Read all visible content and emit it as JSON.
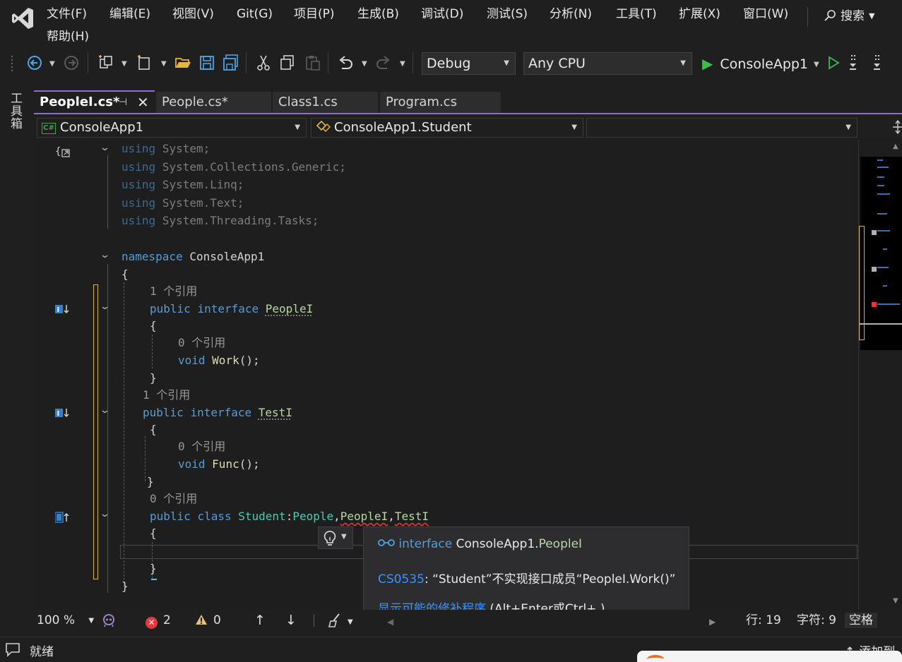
{
  "menu": {
    "items": [
      "文件(F)",
      "编辑(E)",
      "视图(V)",
      "Git(G)",
      "项目(P)",
      "生成(B)",
      "调试(D)",
      "测试(S)",
      "分析(N)",
      "工具(T)",
      "扩展(X)",
      "窗口(W)",
      "帮助(H)"
    ],
    "search_label": "搜索"
  },
  "toolbar": {
    "configuration": "Debug",
    "platform": "Any CPU",
    "startup_project": "ConsoleApp1"
  },
  "toolbox_label": "工具箱",
  "tabs": [
    {
      "label": "PeopleI.cs*",
      "active": true
    },
    {
      "label": "People.cs*",
      "active": false
    },
    {
      "label": "Class1.cs",
      "active": false
    },
    {
      "label": "Program.cs",
      "active": false
    }
  ],
  "navbar": {
    "project": "ConsoleApp1",
    "type": "ConsoleApp1.Student",
    "member": ""
  },
  "code": {
    "using_kw": "using",
    "usings": [
      "System;",
      "System.Collections.Generic;",
      "System.Linq;",
      "System.Text;",
      "System.Threading.Tasks;"
    ],
    "namespace_kw": "namespace",
    "namespace_name": "ConsoleApp1",
    "open_brace": "{",
    "close_brace": "}",
    "lens_1ref": "1 个引用",
    "lens_0ref": "0 个引用",
    "public_kw": "public",
    "interface_kw": "interface",
    "class_kw": "class",
    "void_kw": "void",
    "iface1_name": "PeopleI",
    "iface1_method": "Work",
    "iface2_name": "TestI",
    "iface2_method": "Func",
    "method_suffix": "();",
    "class_name": "Student",
    "base_list": [
      "People",
      "PeopleI",
      "TestI"
    ]
  },
  "quickinfo": {
    "kind": "interface",
    "namespace": "ConsoleApp1.",
    "type_name": "PeopleI",
    "error_code": "CS0535",
    "error_message": ": “Student”不实现接口成员“PeopleI.Work()”",
    "fix_link": "显示可能的修补程序",
    "fix_shortcut": " (Alt+Enter或Ctrl+.)"
  },
  "editor_status": {
    "zoom": "100 %",
    "errors": "2",
    "warnings": "0",
    "line": "行: 19",
    "char": "字符: 9",
    "whitespace": "空格"
  },
  "app_status": {
    "text": "就绪",
    "add_to_source": "添加到"
  },
  "colors": {
    "accent": "#8a6fd8",
    "keyword": "#569cd6",
    "type": "#4ec9b0",
    "interface": "#b8d7a3",
    "method": "#dcdcaa",
    "error": "#e03a3a",
    "run": "#3fba51"
  }
}
